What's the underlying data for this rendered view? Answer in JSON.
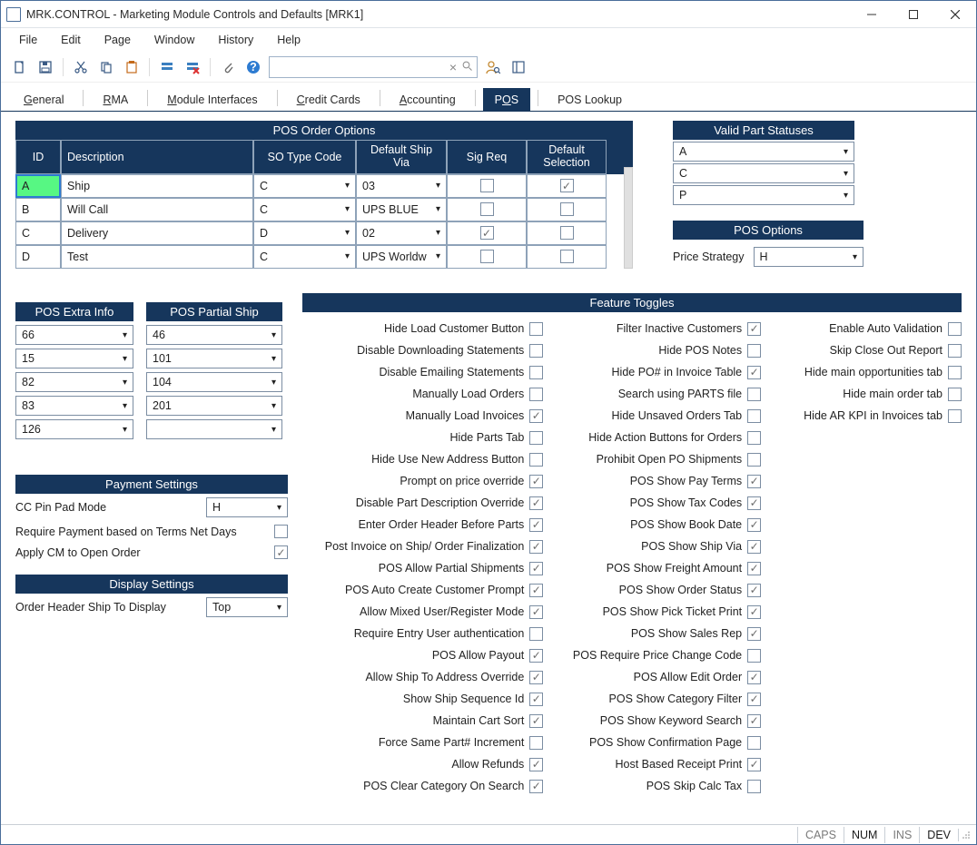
{
  "window": {
    "title": "MRK.CONTROL - Marketing Module Controls and Defaults [MRK1]"
  },
  "menu": [
    "File",
    "Edit",
    "Page",
    "Window",
    "History",
    "Help"
  ],
  "tabs": [
    {
      "label": "General",
      "u": "G"
    },
    {
      "label": "RMA",
      "u": "R"
    },
    {
      "label": "Module Interfaces",
      "u": "M"
    },
    {
      "label": "Credit Cards",
      "u": "C"
    },
    {
      "label": "Accounting",
      "u": "A"
    },
    {
      "label": "POS",
      "u": "O",
      "active": true
    },
    {
      "label": "POS Lookup",
      "u": ""
    }
  ],
  "order_options": {
    "title": "POS Order Options",
    "headers": [
      "ID",
      "Description",
      "SO Type Code",
      "Default Ship Via",
      "Sig Req",
      "Default Selection"
    ],
    "rows": [
      {
        "id": "A",
        "desc": "Ship",
        "so": "C",
        "ship": "03",
        "sig": false,
        "def": true,
        "sel": true
      },
      {
        "id": "B",
        "desc": "Will Call",
        "so": "C",
        "ship": "UPS BLUE",
        "sig": false,
        "def": false
      },
      {
        "id": "C",
        "desc": "Delivery",
        "so": "D",
        "ship": "02",
        "sig": true,
        "def": false
      },
      {
        "id": "D",
        "desc": "Test",
        "so": "C",
        "ship": "UPS Worldw",
        "sig": false,
        "def": false
      }
    ]
  },
  "vps": {
    "title": "Valid Part Statuses",
    "items": [
      "A",
      "C",
      "P"
    ]
  },
  "pos_options": {
    "title": "POS Options",
    "price_strategy_label": "Price Strategy",
    "price_strategy": "H"
  },
  "extra_info": {
    "title": "POS Extra Info",
    "items": [
      "66",
      "15",
      "82",
      "83",
      "126"
    ]
  },
  "partial_ship": {
    "title": "POS Partial Ship",
    "items": [
      "46",
      "101",
      "104",
      "201",
      ""
    ]
  },
  "payment": {
    "title": "Payment Settings",
    "cc_label": "CC Pin Pad Mode",
    "cc_value": "H",
    "req_label": "Require Payment based on Terms Net Days",
    "req_checked": false,
    "cm_label": "Apply CM to Open Order",
    "cm_checked": true
  },
  "display": {
    "title": "Display Settings",
    "row_label": "Order Header Ship To Display",
    "row_value": "Top"
  },
  "ft": {
    "title": "Feature Toggles",
    "col1": [
      {
        "l": "Hide Load Customer Button",
        "c": false
      },
      {
        "l": "Disable Downloading Statements",
        "c": false
      },
      {
        "l": "Disable Emailing Statements",
        "c": false
      },
      {
        "l": "Manually Load Orders",
        "c": false
      },
      {
        "l": "Manually Load Invoices",
        "c": true
      },
      {
        "l": "Hide Parts Tab",
        "c": false
      },
      {
        "l": "Hide Use New Address Button",
        "c": false
      },
      {
        "l": "Prompt on price override",
        "c": true
      },
      {
        "l": "Disable Part Description Override",
        "c": true
      },
      {
        "l": "Enter Order Header Before Parts",
        "c": true
      },
      {
        "l": "Post Invoice on Ship/ Order Finalization",
        "c": true
      },
      {
        "l": "POS Allow Partial Shipments",
        "c": true
      },
      {
        "l": "POS Auto Create Customer Prompt",
        "c": true
      },
      {
        "l": "Allow Mixed User/Register Mode",
        "c": true
      },
      {
        "l": "Require Entry User authentication",
        "c": false
      },
      {
        "l": "POS Allow Payout",
        "c": true
      },
      {
        "l": "Allow Ship To Address Override",
        "c": true
      },
      {
        "l": "Show Ship Sequence Id",
        "c": true
      },
      {
        "l": "Maintain Cart Sort",
        "c": true
      },
      {
        "l": "Force Same Part# Increment",
        "c": false
      },
      {
        "l": "Allow Refunds",
        "c": true
      },
      {
        "l": "POS Clear Category On Search",
        "c": true
      }
    ],
    "col2": [
      {
        "l": "Filter Inactive Customers",
        "c": true
      },
      {
        "l": "Hide POS Notes",
        "c": false
      },
      {
        "l": "Hide PO# in Invoice Table",
        "c": true
      },
      {
        "l": "Search using PARTS file",
        "c": false
      },
      {
        "l": "Hide Unsaved Orders Tab",
        "c": false
      },
      {
        "l": "Hide Action Buttons for Orders",
        "c": false
      },
      {
        "l": "Prohibit Open PO Shipments",
        "c": false
      },
      {
        "l": "POS Show Pay Terms",
        "c": true
      },
      {
        "l": "POS Show Tax Codes",
        "c": true
      },
      {
        "l": "POS Show Book Date",
        "c": true
      },
      {
        "l": "POS Show Ship Via",
        "c": true
      },
      {
        "l": "POS Show Freight Amount",
        "c": true
      },
      {
        "l": "POS Show Order Status",
        "c": true
      },
      {
        "l": "POS Show Pick Ticket Print",
        "c": true
      },
      {
        "l": "POS Show Sales Rep",
        "c": true
      },
      {
        "l": "POS Require Price Change Code",
        "c": false
      },
      {
        "l": "POS Allow Edit Order",
        "c": true
      },
      {
        "l": "POS Show Category Filter",
        "c": true
      },
      {
        "l": "POS Show Keyword Search",
        "c": true
      },
      {
        "l": "POS Show Confirmation Page",
        "c": false
      },
      {
        "l": "Host Based Receipt Print",
        "c": true
      },
      {
        "l": "POS Skip Calc Tax",
        "c": false
      }
    ],
    "col3": [
      {
        "l": "Enable Auto Validation",
        "c": false
      },
      {
        "l": "Skip Close Out Report",
        "c": false
      },
      {
        "l": "Hide main opportunities tab",
        "c": false
      },
      {
        "l": "Hide main order tab",
        "c": false
      },
      {
        "l": "Hide AR KPI in Invoices tab",
        "c": false
      }
    ]
  },
  "status": {
    "caps": "CAPS",
    "num": "NUM",
    "ins": "INS",
    "dev": "DEV"
  }
}
